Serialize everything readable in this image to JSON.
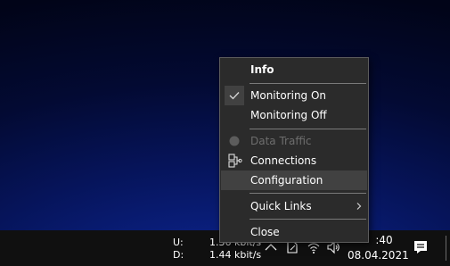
{
  "menu": {
    "info_label": "Info",
    "monitoring_on_label": "Monitoring On",
    "monitoring_off_label": "Monitoring Off",
    "data_traffic_label": "Data Traffic",
    "connections_label": "Connections",
    "configuration_label": "Configuration",
    "quick_links_label": "Quick Links",
    "close_label": "Close"
  },
  "taskbar": {
    "upload_label": "U:",
    "download_label": "D:",
    "upload_value": "1.36 kbit/s",
    "download_value": "1.44 kbit/s",
    "time": ":40",
    "date": "08.04.2021"
  }
}
